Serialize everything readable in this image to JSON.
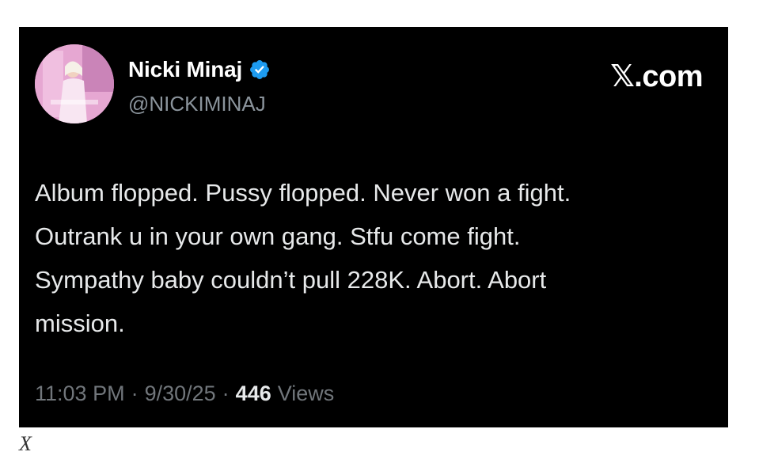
{
  "tweet": {
    "display_name": "Nicki Minaj",
    "handle": "@NICKIMINAJ",
    "brand": "𝕏.com",
    "text": "Album flopped. Pussy flopped. Never won a fight.\nOutrank u in your own gang. Stfu come fight.\nSympathy baby couldn’t pull 228K. Abort. Abort\nmission.",
    "time": "11:03 PM",
    "date": "9/30/25",
    "views_count": "446",
    "views_label": "Views",
    "separator": "·",
    "verified_color": "#1d9bf0"
  },
  "caption": "X"
}
